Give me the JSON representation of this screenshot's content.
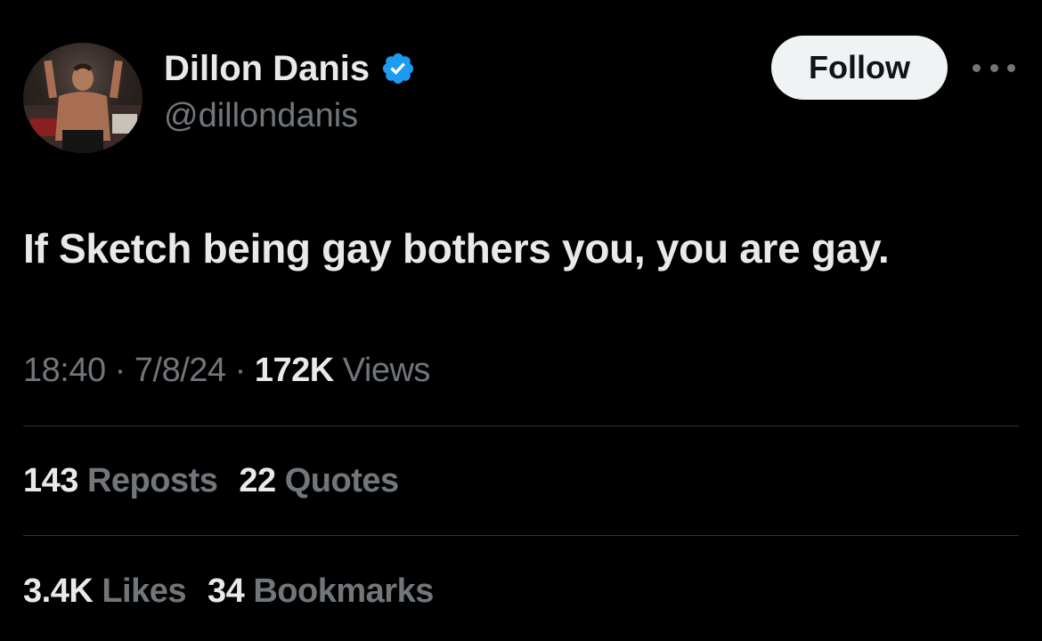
{
  "author": {
    "display_name": "Dillon Danis",
    "handle": "@dillondanis",
    "verified_icon": "verified-badge-icon",
    "verified_color": "#1d9bf0"
  },
  "follow_button": {
    "label": "Follow"
  },
  "more_menu": {
    "icon": "more-horizontal-icon"
  },
  "tweet": {
    "text": "If Sketch being gay bothers you, you are gay."
  },
  "meta": {
    "time": "18:40",
    "sep1": " · ",
    "date": "7/8/24",
    "sep2": " · ",
    "views_count": "172K",
    "views_label": " Views"
  },
  "stats": {
    "reposts_count": "143",
    "reposts_label": " Reposts",
    "quotes_count": "22",
    "quotes_label": " Quotes",
    "likes_count": "3.4K",
    "likes_label": " Likes",
    "bookmarks_count": "34",
    "bookmarks_label": " Bookmarks"
  },
  "colors": {
    "background": "#000000",
    "primary_text": "#e7e9ea",
    "secondary_text": "#71767b",
    "divider": "#2f3336",
    "button_bg": "#eff3f4"
  }
}
